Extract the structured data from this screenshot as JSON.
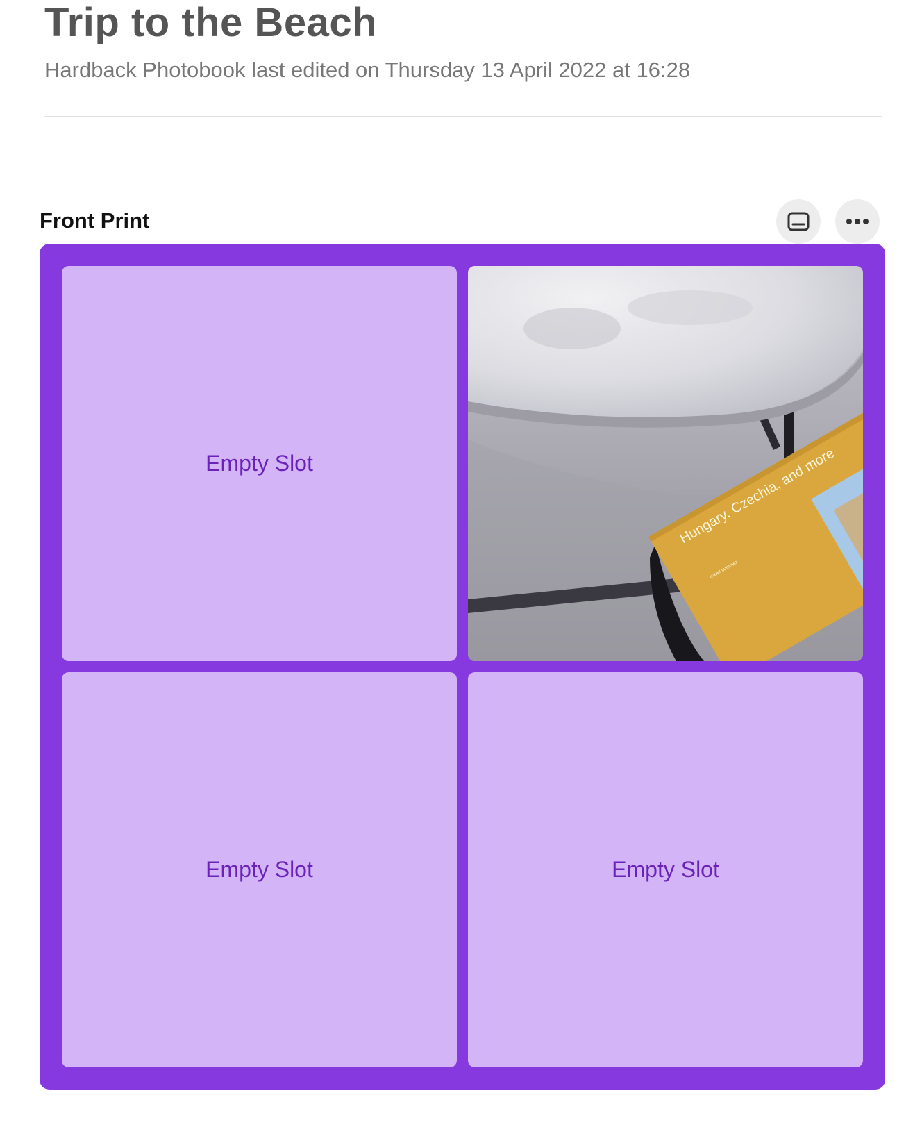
{
  "project": {
    "title": "Trip to the Beach",
    "subtitle": "Hardback Photobook last edited on Thursday 13 April 2022 at 16:28"
  },
  "section": {
    "title": "Front Print",
    "actions": [
      {
        "icon": "layout-icon"
      },
      {
        "icon": "more-options-icon"
      }
    ]
  },
  "colors": {
    "frame": "#8739e0",
    "slot_background": "#d3b5f7",
    "slot_text": "#6a22b8",
    "book_cover": "#d9a73d"
  },
  "slots": [
    {
      "label": "Empty Slot",
      "state": "empty"
    },
    {
      "state": "filled",
      "photo_text": "Hungary, Czechia, and more",
      "photo_subtext": "travel summer"
    },
    {
      "label": "Empty Slot",
      "state": "empty"
    },
    {
      "label": "Empty Slot",
      "state": "empty"
    }
  ]
}
